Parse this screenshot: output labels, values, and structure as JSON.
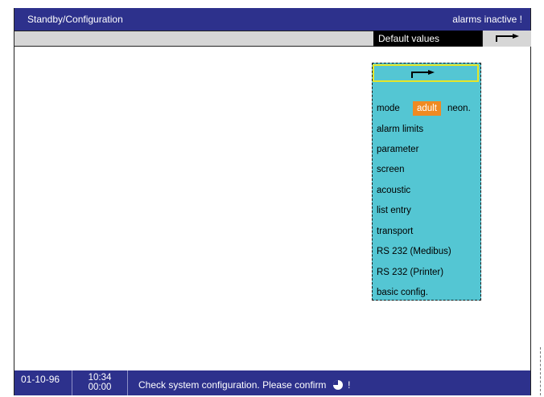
{
  "header": {
    "title": "Standby/Configuration",
    "alarm_status": "alarms inactive !"
  },
  "toolbar": {
    "default_values_label": "Default values",
    "next_arrow_icon": "right-arrow-icon"
  },
  "menu": {
    "header_icon": "right-arrow-icon",
    "mode": {
      "label": "mode",
      "selected": "adult",
      "other": "neon."
    },
    "items": [
      "alarm limits",
      "parameter",
      "screen",
      "acoustic",
      "list entry",
      "transport",
      "RS 232 (Medibus)",
      "RS 232 (Printer)",
      "basic config."
    ]
  },
  "status": {
    "date": "01-10-96",
    "time": "10:34",
    "elapsed": "00:00",
    "message": "Check system configuration. Please confirm",
    "message_suffix": "!",
    "confirm_icon": "rotary-knob-icon"
  },
  "colors": {
    "bar": "#2d318c",
    "menu_bg": "#54c6d3",
    "highlight": "#f08a22",
    "focus_border": "#e6e628",
    "toolbar_bg": "#d6d6d6"
  }
}
